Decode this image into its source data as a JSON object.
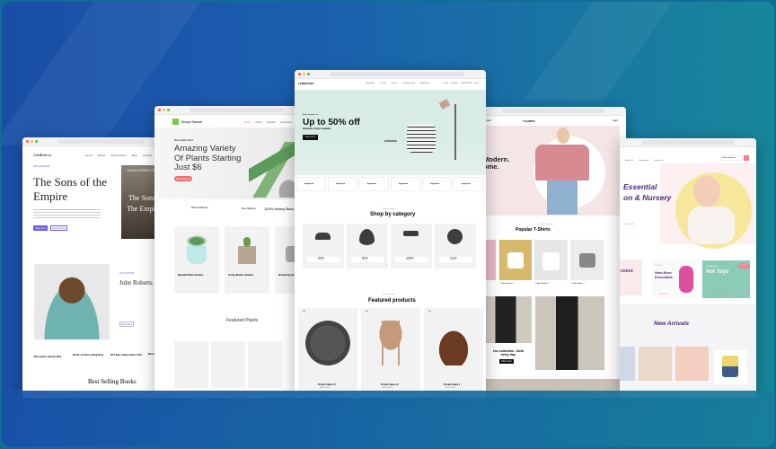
{
  "colors": {
    "bg_left": "#1a4ea6",
    "bg_right": "#17879a",
    "books_accent": "#6c5ce7",
    "plants_accent": "#f26c6c",
    "plants_green": "#7ac943",
    "baby_purple": "#4b2a7b",
    "baby_pink": "#f37d8e"
  },
  "books": {
    "logo": "JohnRoberts",
    "nav": [
      "Home",
      "Books",
      "About Author",
      "Blog",
      "Contact"
    ],
    "eyebrow": "NEW RELEASE",
    "title": "The Sons of the Empire",
    "buttons": [
      "Shop Now",
      "Read Sample"
    ],
    "cover_text": [
      "JOHN ROBERTS",
      "The Sons",
      "of",
      "The Empire"
    ],
    "author_eyebrow": "THE AUTHOR",
    "author_name": "John Roberts",
    "read_more": "Read More",
    "awards": [
      "Best Author Awards 2019",
      "World's #1 Best selling Book",
      "NYT Best selling Author 2019",
      "Best Author"
    ],
    "section": "Best Selling Books"
  },
  "plants": {
    "logo": "Simply Natural",
    "nav": [
      "Home",
      "Plants",
      "Benefits",
      "Resources",
      "About Us"
    ],
    "eyebrow": "Best Quality Plants",
    "title_lines": [
      "Amazing Variety",
      "Of Plants Starting",
      "Just $6"
    ],
    "cta": "Start Shopping",
    "features": [
      "Plants Collection",
      "Free Shipping",
      "100% Money Back"
    ],
    "products": [
      "Beautiful Plant Varieties",
      "Trendy Planter Varieties",
      "Wondering About Plants"
    ],
    "section": "Featured Plants"
  },
  "furniture": {
    "logo": "FURNITURE",
    "nav": [
      "SHOP ALL",
      "ROOM",
      "STYLE",
      "LIVING ROOM",
      "BEDROOM"
    ],
    "nav_right": [
      "SHOP",
      "SERVICE",
      "INSPIRATIONS",
      "BLOG",
      "Login"
    ],
    "eyebrow": "Black Friday is on",
    "headline": "Up to 50% off",
    "subline": "Hundreds of styles available",
    "cta": "SHOP NOW",
    "brands": [
      "logoipsum",
      "logoipsum",
      "logoipsum",
      "logoipsum",
      "logoipsum",
      "logoipsum"
    ],
    "category_eyebrow": "Shop by category",
    "category_title": "Shop by category",
    "categories": [
      {
        "name": "ROOMS",
        "count": "4 Products"
      },
      {
        "name": "DECOR",
        "count": "4 Products"
      },
      {
        "name": "LIGHTING",
        "count": "4 Products"
      },
      {
        "name": "CLOCKS",
        "count": "4 Products"
      }
    ],
    "featured_eyebrow": "Shop by category",
    "featured_title": "Featured products",
    "products": [
      {
        "name": "Product Name 10",
        "price": "$45.00 - $55.00"
      },
      {
        "name": "Product Name 12",
        "price": "$45.00 - $55.00"
      },
      {
        "name": "Product Name 2",
        "price": "$45.00 - $55.00"
      }
    ],
    "badge": "Sale"
  },
  "tshirts": {
    "logo": "T-SHIRTS",
    "nav": [
      "Contact"
    ],
    "nav_right": [
      "Login"
    ],
    "hero": [
      "Modern.",
      "ome."
    ],
    "eyebrow": "Summer Collection",
    "section": "Popular T-Shirts",
    "products": [
      "T-Shirt Name 4",
      "T-Shirt Name 8",
      "T-Shirt Name 7"
    ],
    "collection": [
      "ese collection - Ideal",
      "every day."
    ],
    "cta": "Shop Now"
  },
  "baby": {
    "nav": [
      "About Us",
      "Testimonial",
      "Contact Us"
    ],
    "search": "Search products...",
    "hero": [
      "Essential",
      "on & Nursery"
    ],
    "cta": "SHOP NOW",
    "promos": [
      {
        "tag": "",
        "title": "ccess",
        "cta": "SHOP NOW"
      },
      {
        "tag": "20% OFF",
        "title": "New Born Essentials",
        "cta": "SHOP NOW"
      },
      {
        "tag": "NEW ARRIVALS",
        "title": "Hot Toys",
        "badge": "30% OFF",
        "cta": "SHOP NOW"
      }
    ],
    "section": "New Arrivals"
  }
}
